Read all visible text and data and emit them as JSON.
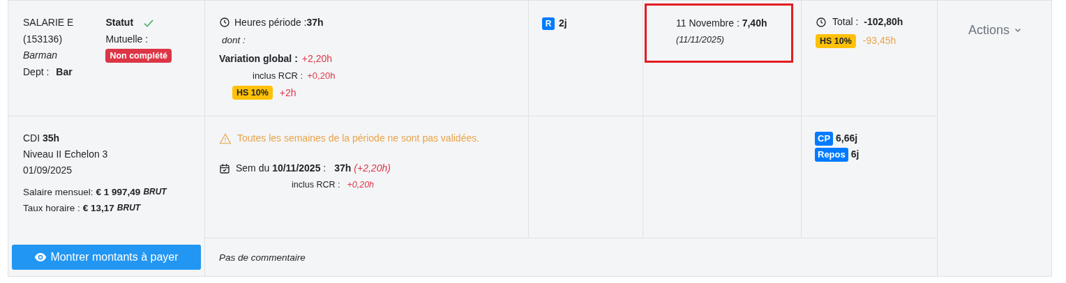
{
  "employee": {
    "name": "SALARIE E",
    "id": "(153136)",
    "job": "Barman",
    "dept_label": "Dept :",
    "dept": "Bar"
  },
  "status": {
    "label": "Statut",
    "validated": true,
    "mutuelle_label": "Mutuelle :",
    "mutuelle_badge": "Non complété"
  },
  "hours": {
    "period": "Heures période :**37h**",
    "dont": "dont :",
    "variation_label": "Variation global :",
    "variation": "+2,20h",
    "rcr_label": "inclus RCR :",
    "rcr": "+0,20h",
    "hs_badge": "HS 10%",
    "hs": "+2h"
  },
  "rest": {
    "badge": "R",
    "value": "2j"
  },
  "holiday": {
    "title": "11 Novembre : **7,40h**",
    "date": "(11/11/2025)",
    "highlighted": true
  },
  "totals": {
    "label": "Total :",
    "value": "-102,80h",
    "hs_badge": "HS 10%",
    "hs": "-93,45h"
  },
  "actions": {
    "label": "Actions"
  },
  "contract": {
    "type": "CDI **35h**",
    "level": "Niveau II Echelon 3",
    "start": "01/09/2025",
    "salary_label": "Salaire mensuel:",
    "salary": "€ 1 997,49",
    "salary_unit": "BRUT",
    "rate_label": "Taux horaire :",
    "rate": "€ 13,17",
    "rate_unit": "BRUT"
  },
  "warning": "Toutes les semaines de la période ne sont pas validées.",
  "weeks": [
    {
      "label": "Sem du **10/11/2025** :",
      "hours": "37h",
      "variation": "(+2,20h)",
      "rcr_label": "inclus RCR :",
      "rcr": "+0,20h"
    }
  ],
  "balances": [
    {
      "badge": "CP",
      "value": "6,66j"
    },
    {
      "badge": "Repos",
      "value": "6j"
    }
  ],
  "pay_button": "Montrer montants à payer",
  "comment": "Pas de commentaire"
}
